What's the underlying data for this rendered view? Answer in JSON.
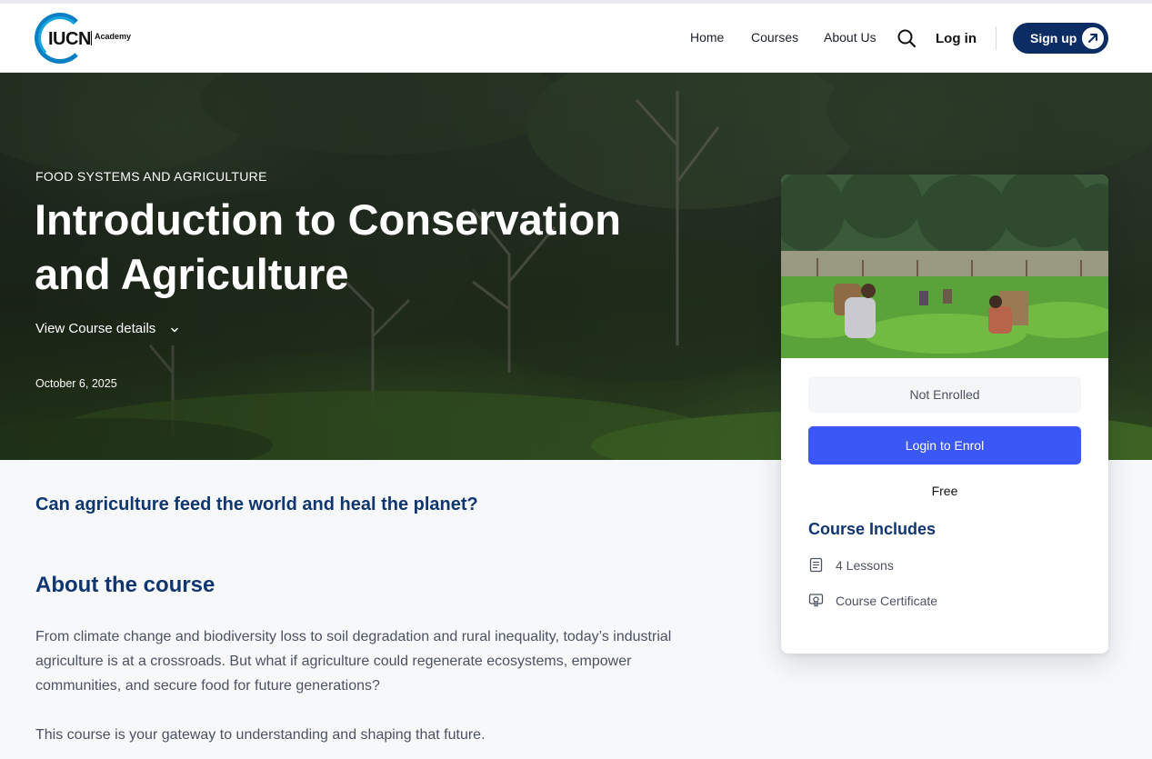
{
  "header": {
    "logo_word": "IUCN",
    "logo_sub": "Academy",
    "nav": [
      {
        "label": "Home"
      },
      {
        "label": "Courses"
      },
      {
        "label": "About Us"
      }
    ],
    "search_icon": "search-icon",
    "login_label": "Log in",
    "signup_label": "Sign up",
    "signup_icon": "arrow-up-right-icon"
  },
  "hero": {
    "category": "FOOD SYSTEMS AND AGRICULTURE",
    "title": "Introduction to Conservation and Agriculture",
    "details_toggle": "View Course details",
    "date": "October 6, 2025"
  },
  "content": {
    "tagline": "Can agriculture feed the world and heal the planet?",
    "about_heading": "About the course",
    "paragraphs": [
      "From climate change and biodiversity loss to soil degradation and rural inequality, today’s industrial agriculture is at a crossroads. But what if agriculture could regenerate ecosystems, empower communities, and secure food for future generations?",
      "This course is your gateway to understanding and shaping that future."
    ]
  },
  "card": {
    "status": "Not Enrolled",
    "enrol_button": "Login to Enrol",
    "price": "Free",
    "includes_heading": "Course Includes",
    "includes": [
      {
        "label": "4 Lessons",
        "icon": "lessons-icon"
      },
      {
        "label": "Course Certificate",
        "icon": "certificate-icon"
      }
    ]
  },
  "colors": {
    "brand_navy": "#0b2d63",
    "heading_blue": "#10366f",
    "button_blue": "#3b57f5",
    "logo_blue": "#0a7fc4"
  }
}
